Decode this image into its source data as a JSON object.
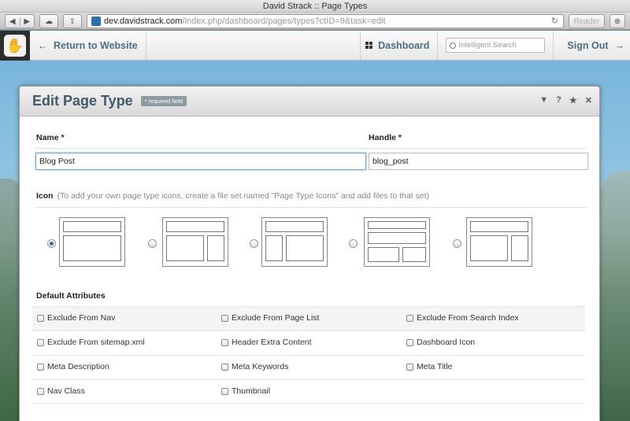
{
  "browser": {
    "window_title": "David Strack :: Page Types",
    "url_domain": "dev.davidstrack.com",
    "url_path": "/index.php/dashboard/pages/types?ctID=9&task=edit",
    "reader_label": "Reader"
  },
  "cmsbar": {
    "return_label": "Return to Website",
    "dashboard_label": "Dashboard",
    "search_placeholder": "Intelligent Search",
    "signout_label": "Sign Out"
  },
  "dialog": {
    "title": "Edit Page Type",
    "required_badge": "* required field",
    "name_label": "Name *",
    "name_value": "Blog Post",
    "handle_label": "Handle *",
    "handle_value": "blog_post",
    "icon_label": "Icon",
    "icon_hint": "(To add your own page type icons, create a file set named \"Page Type Icons\" and add files to that set)",
    "selected_icon_index": 0,
    "attributes_label": "Default Attributes",
    "attributes": [
      [
        "Exclude From Nav",
        "Exclude From Page List",
        "Exclude From Search Index"
      ],
      [
        "Exclude From sitemap.xml",
        "Header Extra Content",
        "Dashboard Icon"
      ],
      [
        "Meta Description",
        "Meta Keywords",
        "Meta Title"
      ],
      [
        "Nav Class",
        "Thumbnail",
        ""
      ]
    ]
  }
}
